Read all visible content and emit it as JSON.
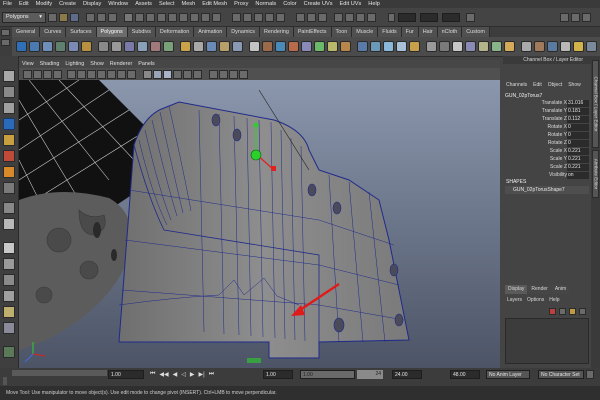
{
  "menubar": [
    "File",
    "Edit",
    "Modify",
    "Create",
    "Display",
    "Window",
    "Assets",
    "Select",
    "Mesh",
    "Edit Mesh",
    "Proxy",
    "Normals",
    "Color",
    "Create UVs",
    "Edit UVs",
    "Help"
  ],
  "status": {
    "mode": "Polygons"
  },
  "shelf": {
    "tabs": [
      "General",
      "Curves",
      "Surfaces",
      "Polygons",
      "Subdivs",
      "Deformation",
      "Animation",
      "Dynamics",
      "Rendering",
      "PaintEffects",
      "Toon",
      "Muscle",
      "Fluids",
      "Fur",
      "Hair",
      "nCloth",
      "Custom"
    ],
    "active": "Polygons"
  },
  "panel": {
    "menu": [
      "View",
      "Shading",
      "Lighting",
      "Show",
      "Renderer",
      "Panels"
    ]
  },
  "channel_box": {
    "title": "Channel Box / Layer Editor",
    "menu": [
      "Channels",
      "Edit",
      "Object",
      "Show"
    ],
    "object": "GUN_02pTorus7",
    "attributes": [
      {
        "label": "Translate X",
        "value": "31.016"
      },
      {
        "label": "Translate Y",
        "value": "0.181"
      },
      {
        "label": "Translate Z",
        "value": "0.112"
      },
      {
        "label": "Rotate X",
        "value": "0"
      },
      {
        "label": "Rotate Y",
        "value": "0"
      },
      {
        "label": "Rotate Z",
        "value": "0"
      },
      {
        "label": "Scale X",
        "value": "0.221"
      },
      {
        "label": "Scale Y",
        "value": "0.221"
      },
      {
        "label": "Scale Z",
        "value": "0.221"
      },
      {
        "label": "Visibility",
        "value": "on"
      }
    ],
    "shapes_label": "SHAPES",
    "shape": "GUN_02pTorusShape7"
  },
  "layer_editor": {
    "tabs": [
      "Display",
      "Render",
      "Anim"
    ],
    "menu": [
      "Layers",
      "Options",
      "Help"
    ]
  },
  "side_tabs": [
    "Channel Box / Layer Editor",
    "Attribute Editor"
  ],
  "timeline": {
    "start": "1.00",
    "current": "1.00",
    "range_start": "1.00",
    "range_end": "24",
    "end": "24.00",
    "end2": "48.00",
    "anim_layer": "No Anim Layer",
    "char_set": "No Character Set"
  },
  "help": "Move Tool: Use manipulator to move object(s). Use edit mode to change pivot (INSERT). Ctrl+LMB to move perpendicular.",
  "colors": {
    "viewport_top": "#7f8aa0",
    "viewport_bottom": "#4b5363",
    "wire": "#1f2a8a",
    "mesh": "#8a8a8a",
    "arrow": "#e11a1a"
  }
}
